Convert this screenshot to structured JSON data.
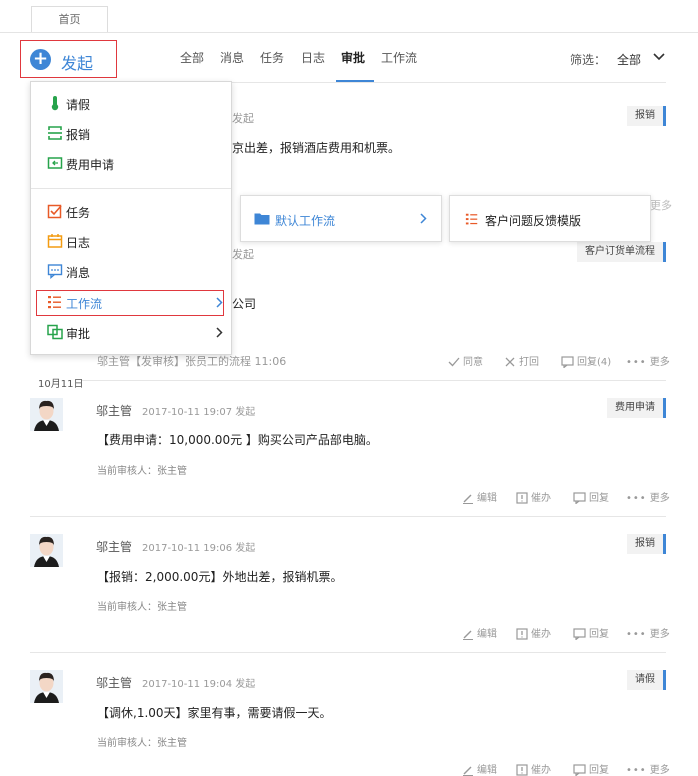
{
  "tab": {
    "home": "首页"
  },
  "launch": {
    "label": "发起"
  },
  "nav": {
    "tabs": [
      "全部",
      "消息",
      "任务",
      "日志",
      "审批",
      "工作流"
    ],
    "active": "审批"
  },
  "filter": {
    "label": "筛选：",
    "value": "全部"
  },
  "partial": {
    "row1_tail": "发起",
    "row1_tag": "报销",
    "row1_content": "京出差，报销酒店费用和机票。",
    "row1_more": "更多",
    "row2_tail": "发起",
    "row2_tag": "客户订货单流程",
    "row2_content": "公司",
    "row2_meta": "邬主管【发审核】张员工的流程 11:06",
    "actions": {
      "agree": "同意",
      "back": "打回",
      "reply": "回复(4)",
      "more": "更多"
    }
  },
  "menu": {
    "items": [
      "请假",
      "报销",
      "费用申请",
      "任务",
      "日志",
      "消息",
      "工作流",
      "审批"
    ]
  },
  "submenu": {
    "default": "默认工作流",
    "custom": "客户问题反馈模版"
  },
  "date_label": "10月11日",
  "posts": [
    {
      "name": "邬主管",
      "time": "2017-10-11 19:07 发起",
      "tag": "费用申请",
      "content": "【费用申请：10,000.00元 】购买公司产品部电脑。",
      "auditor": "当前审核人：张主管"
    },
    {
      "name": "邬主管",
      "time": "2017-10-11 19:06 发起",
      "tag": "报销",
      "content": "【报销：2,000.00元】外地出差，报销机票。",
      "auditor": "当前审核人：张主管"
    },
    {
      "name": "邬主管",
      "time": "2017-10-11 19:04 发起",
      "tag": "请假",
      "content": "【调休,1.00天】家里有事，需要请假一天。",
      "auditor": "当前审核人：张主管"
    }
  ],
  "post_actions": {
    "edit": "编辑",
    "urge": "催办",
    "reply": "回复",
    "more": "更多"
  },
  "colors": {
    "accent": "#3e86d6",
    "highlight": "#e0383e"
  }
}
